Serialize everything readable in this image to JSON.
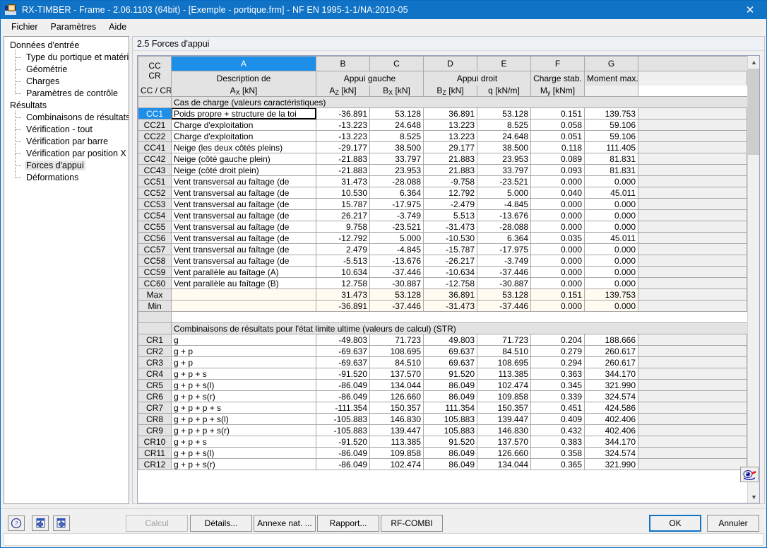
{
  "window": {
    "title": "RX-TIMBER - Frame - 2.06.1103 (64bit) - [Exemple - portique.frm] - NF EN 1995-1-1/NA:2010-05",
    "close_label": "✕",
    "app_icon": "rx-timber-icon"
  },
  "menubar": {
    "items": [
      {
        "label": "Fichier"
      },
      {
        "label": "Paramètres"
      },
      {
        "label": "Aide"
      }
    ]
  },
  "sidebar": {
    "groups": [
      {
        "label": "Données d'entrée",
        "items": [
          {
            "label": "Type du portique et matériau"
          },
          {
            "label": "Géométrie"
          },
          {
            "label": "Charges"
          },
          {
            "label": "Paramètres de contrôle"
          }
        ]
      },
      {
        "label": "Résultats",
        "items": [
          {
            "label": "Combinaisons de résultats"
          },
          {
            "label": "Vérification - tout"
          },
          {
            "label": "Vérification par barre"
          },
          {
            "label": "Vérification par position X"
          },
          {
            "label": "Forces d'appui"
          },
          {
            "label": "Déformations"
          }
        ]
      }
    ],
    "selected": "Forces d'appui"
  },
  "pane": {
    "title": "2.5 Forces d'appui"
  },
  "table": {
    "column_letters": [
      "",
      "A",
      "B",
      "C",
      "D",
      "E",
      "F",
      "G",
      ""
    ],
    "selected_column_letter": "A",
    "corner_header_line1": "CC",
    "corner_header_line2": "CR",
    "group_headers": [
      {
        "label": "Description de",
        "span": 1
      },
      {
        "label": "Appui gauche",
        "span": 2
      },
      {
        "label": "Appui droit",
        "span": 2
      },
      {
        "label": "Charge stab.",
        "span": 1
      },
      {
        "label": "Moment max.",
        "span": 1
      }
    ],
    "sub_headers": [
      {
        "base": "CC / CR",
        "sub": ""
      },
      {
        "base": "A",
        "sub": "X",
        "unit": " [kN]"
      },
      {
        "base": "A",
        "sub": "Z",
        "unit": " [kN]"
      },
      {
        "base": "B",
        "sub": "X",
        "unit": " [kN]"
      },
      {
        "base": "B",
        "sub": "Z",
        "unit": " [kN]"
      },
      {
        "base": "q",
        "sub": "",
        "unit": " [kN/m]"
      },
      {
        "base": "M",
        "sub": "y",
        "unit": " [kNm]"
      }
    ],
    "sections": [
      {
        "title": "Cas de charge (valeurs caractéristiques)",
        "rows": [
          {
            "id": "CC1",
            "desc": "Poids propre + structure de la toi",
            "values": [
              "-36.891",
              "53.128",
              "36.891",
              "53.128",
              "0.151",
              "139.753"
            ],
            "selected": true
          },
          {
            "id": "CC21",
            "desc": "Charge d'exploitation",
            "values": [
              "-13.223",
              "24.648",
              "13.223",
              "8.525",
              "0.058",
              "59.106"
            ]
          },
          {
            "id": "CC22",
            "desc": "Charge d'exploitation",
            "values": [
              "-13.223",
              "8.525",
              "13.223",
              "24.648",
              "0.051",
              "59.106"
            ]
          },
          {
            "id": "CC41",
            "desc": "Neige (les deux côtés pleins)",
            "values": [
              "-29.177",
              "38.500",
              "29.177",
              "38.500",
              "0.118",
              "111.405"
            ]
          },
          {
            "id": "CC42",
            "desc": "Neige (côté gauche plein)",
            "values": [
              "-21.883",
              "33.797",
              "21.883",
              "23.953",
              "0.089",
              "81.831"
            ]
          },
          {
            "id": "CC43",
            "desc": "Neige (côté droit plein)",
            "values": [
              "-21.883",
              "23.953",
              "21.883",
              "33.797",
              "0.093",
              "81.831"
            ]
          },
          {
            "id": "CC51",
            "desc": "Vent transversal au faîtage (de",
            "values": [
              "31.473",
              "-28.088",
              "-9.758",
              "-23.521",
              "0.000",
              "0.000"
            ]
          },
          {
            "id": "CC52",
            "desc": "Vent transversal au faîtage (de",
            "values": [
              "10.530",
              "6.364",
              "12.792",
              "5.000",
              "0.040",
              "45.011"
            ]
          },
          {
            "id": "CC53",
            "desc": "Vent transversal au faîtage (de",
            "values": [
              "15.787",
              "-17.975",
              "-2.479",
              "-4.845",
              "0.000",
              "0.000"
            ]
          },
          {
            "id": "CC54",
            "desc": "Vent transversal au faîtage (de",
            "values": [
              "26.217",
              "-3.749",
              "5.513",
              "-13.676",
              "0.000",
              "0.000"
            ]
          },
          {
            "id": "CC55",
            "desc": "Vent transversal au faîtage (de",
            "values": [
              "9.758",
              "-23.521",
              "-31.473",
              "-28.088",
              "0.000",
              "0.000"
            ]
          },
          {
            "id": "CC56",
            "desc": "Vent transversal au faîtage (de",
            "values": [
              "-12.792",
              "5.000",
              "-10.530",
              "6.364",
              "0.035",
              "45.011"
            ]
          },
          {
            "id": "CC57",
            "desc": "Vent transversal au faîtage (de",
            "values": [
              "2.479",
              "-4.845",
              "-15.787",
              "-17.975",
              "0.000",
              "0.000"
            ]
          },
          {
            "id": "CC58",
            "desc": "Vent transversal au faîtage (de",
            "values": [
              "-5.513",
              "-13.676",
              "-26.217",
              "-3.749",
              "0.000",
              "0.000"
            ]
          },
          {
            "id": "CC59",
            "desc": "Vent parallèle au faîtage (A)",
            "values": [
              "10.634",
              "-37.446",
              "-10.634",
              "-37.446",
              "0.000",
              "0.000"
            ]
          },
          {
            "id": "CC60",
            "desc": "Vent parallèle au faîtage (B)",
            "values": [
              "12.758",
              "-30.887",
              "-12.758",
              "-30.887",
              "0.000",
              "0.000"
            ]
          },
          {
            "id": "Max",
            "desc": "",
            "values": [
              "31.473",
              "53.128",
              "36.891",
              "53.128",
              "0.151",
              "139.753"
            ],
            "minmax": true
          },
          {
            "id": "Min",
            "desc": "",
            "values": [
              "-36.891",
              "-37.446",
              "-31.473",
              "-37.446",
              "0.000",
              "0.000"
            ],
            "minmax": true
          }
        ]
      },
      {
        "title": "Combinaisons de résultats pour l'état limite ultime (valeurs de calcul) (STR)",
        "rows": [
          {
            "id": "CR1",
            "desc": "g",
            "values": [
              "-49.803",
              "71.723",
              "49.803",
              "71.723",
              "0.204",
              "188.666"
            ]
          },
          {
            "id": "CR2",
            "desc": "g + p",
            "values": [
              "-69.637",
              "108.695",
              "69.637",
              "84.510",
              "0.279",
              "260.617"
            ]
          },
          {
            "id": "CR3",
            "desc": "g + p",
            "values": [
              "-69.637",
              "84.510",
              "69.637",
              "108.695",
              "0.294",
              "260.617"
            ]
          },
          {
            "id": "CR4",
            "desc": "g + p + s",
            "values": [
              "-91.520",
              "137.570",
              "91.520",
              "113.385",
              "0.363",
              "344.170"
            ]
          },
          {
            "id": "CR5",
            "desc": "g + p + s(l)",
            "values": [
              "-86.049",
              "134.044",
              "86.049",
              "102.474",
              "0.345",
              "321.990"
            ]
          },
          {
            "id": "CR6",
            "desc": "g + p + s(r)",
            "values": [
              "-86.049",
              "126.660",
              "86.049",
              "109.858",
              "0.339",
              "324.574"
            ]
          },
          {
            "id": "CR7",
            "desc": "g + p + p + s",
            "values": [
              "-111.354",
              "150.357",
              "111.354",
              "150.357",
              "0.451",
              "424.586"
            ]
          },
          {
            "id": "CR8",
            "desc": "g + p + p + s(l)",
            "values": [
              "-105.883",
              "146.830",
              "105.883",
              "139.447",
              "0.409",
              "402.406"
            ]
          },
          {
            "id": "CR9",
            "desc": "g + p + p + s(r)",
            "values": [
              "-105.883",
              "139.447",
              "105.883",
              "146.830",
              "0.432",
              "402.406"
            ]
          },
          {
            "id": "CR10",
            "desc": "g + p + s",
            "values": [
              "-91.520",
              "113.385",
              "91.520",
              "137.570",
              "0.383",
              "344.170"
            ]
          },
          {
            "id": "CR11",
            "desc": "g + p + s(l)",
            "values": [
              "-86.049",
              "109.858",
              "86.049",
              "126.660",
              "0.358",
              "324.574"
            ]
          },
          {
            "id": "CR12",
            "desc": "g + p + s(r)",
            "values": [
              "-86.049",
              "102.474",
              "86.049",
              "134.044",
              "0.365",
              "321.990"
            ]
          }
        ]
      }
    ]
  },
  "scrollbar": {
    "up_arrow": "▲",
    "down_arrow": "▼"
  },
  "view_button": {
    "icon": "eye-view-icon"
  },
  "bottombar": {
    "tool_buttons": [
      {
        "icon": "help-icon",
        "glyph": "?"
      },
      {
        "icon": "previous-page-icon",
        "glyph": "◀"
      },
      {
        "icon": "next-page-icon",
        "glyph": "▶"
      }
    ],
    "buttons": [
      {
        "label": "Calcul",
        "disabled": true
      },
      {
        "label": "Détails...",
        "disabled": false
      },
      {
        "label": "Annexe nat. ...",
        "disabled": false
      },
      {
        "label": "Rapport...",
        "disabled": false
      },
      {
        "label": "RF-COMBI",
        "disabled": false
      }
    ],
    "ok_label": "OK",
    "cancel_label": "Annuler"
  },
  "colors": {
    "accent": "#1073c6",
    "selection": "#1d8fe8",
    "header_bg": "#e3e3e3",
    "minmax_bg": "#fffbf0"
  }
}
